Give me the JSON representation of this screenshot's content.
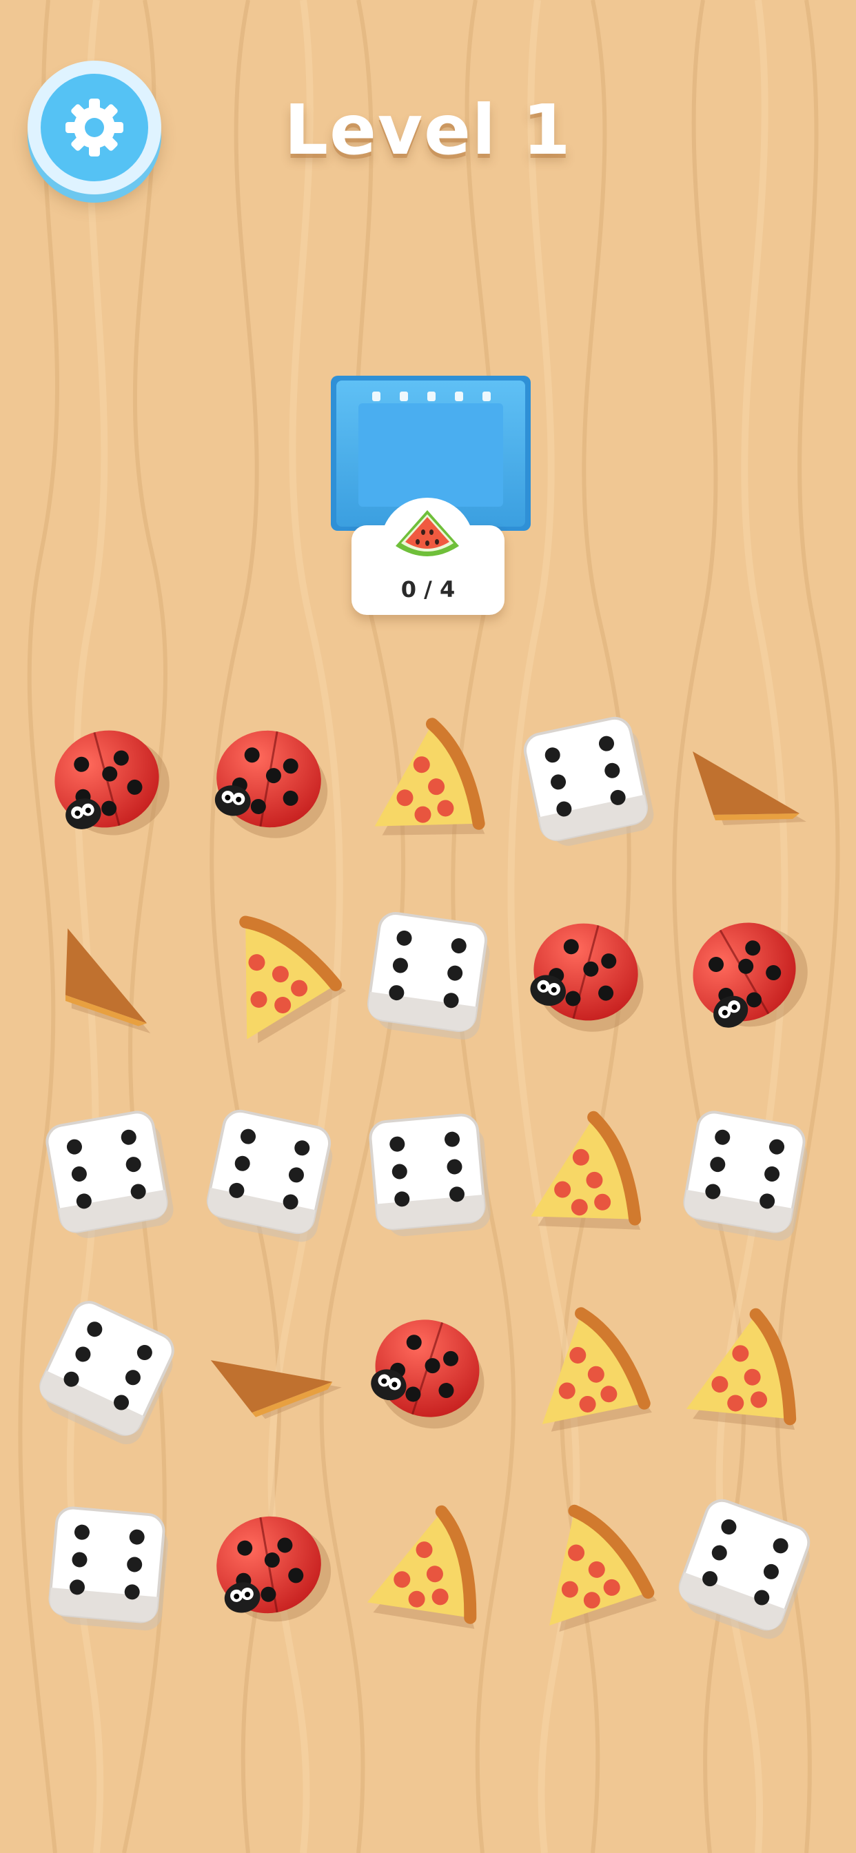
{
  "header": {
    "level_title": "Level 1",
    "settings_icon": "gear-icon"
  },
  "goal": {
    "target_item": "watermelon-slice-icon",
    "progress_text": "0 / 4",
    "collected": 0,
    "required": 4
  },
  "colors": {
    "background": "#f0c793",
    "basket": "#4fb3ee",
    "settings_button": "#55c2f4",
    "title_text": "#ffffff"
  },
  "grid": {
    "rows": [
      [
        "ladybug",
        "ladybug",
        "pizza-slice",
        "die",
        "cone"
      ],
      [
        "cone",
        "pizza-slice",
        "die",
        "ladybug",
        "ladybug"
      ],
      [
        "die",
        "die",
        "die",
        "pizza-slice",
        "die"
      ],
      [
        "die",
        "cone",
        "ladybug",
        "pizza-slice",
        "pizza-slice"
      ],
      [
        "die",
        "ladybug",
        "pizza-slice",
        "pizza-slice",
        "die"
      ]
    ]
  }
}
